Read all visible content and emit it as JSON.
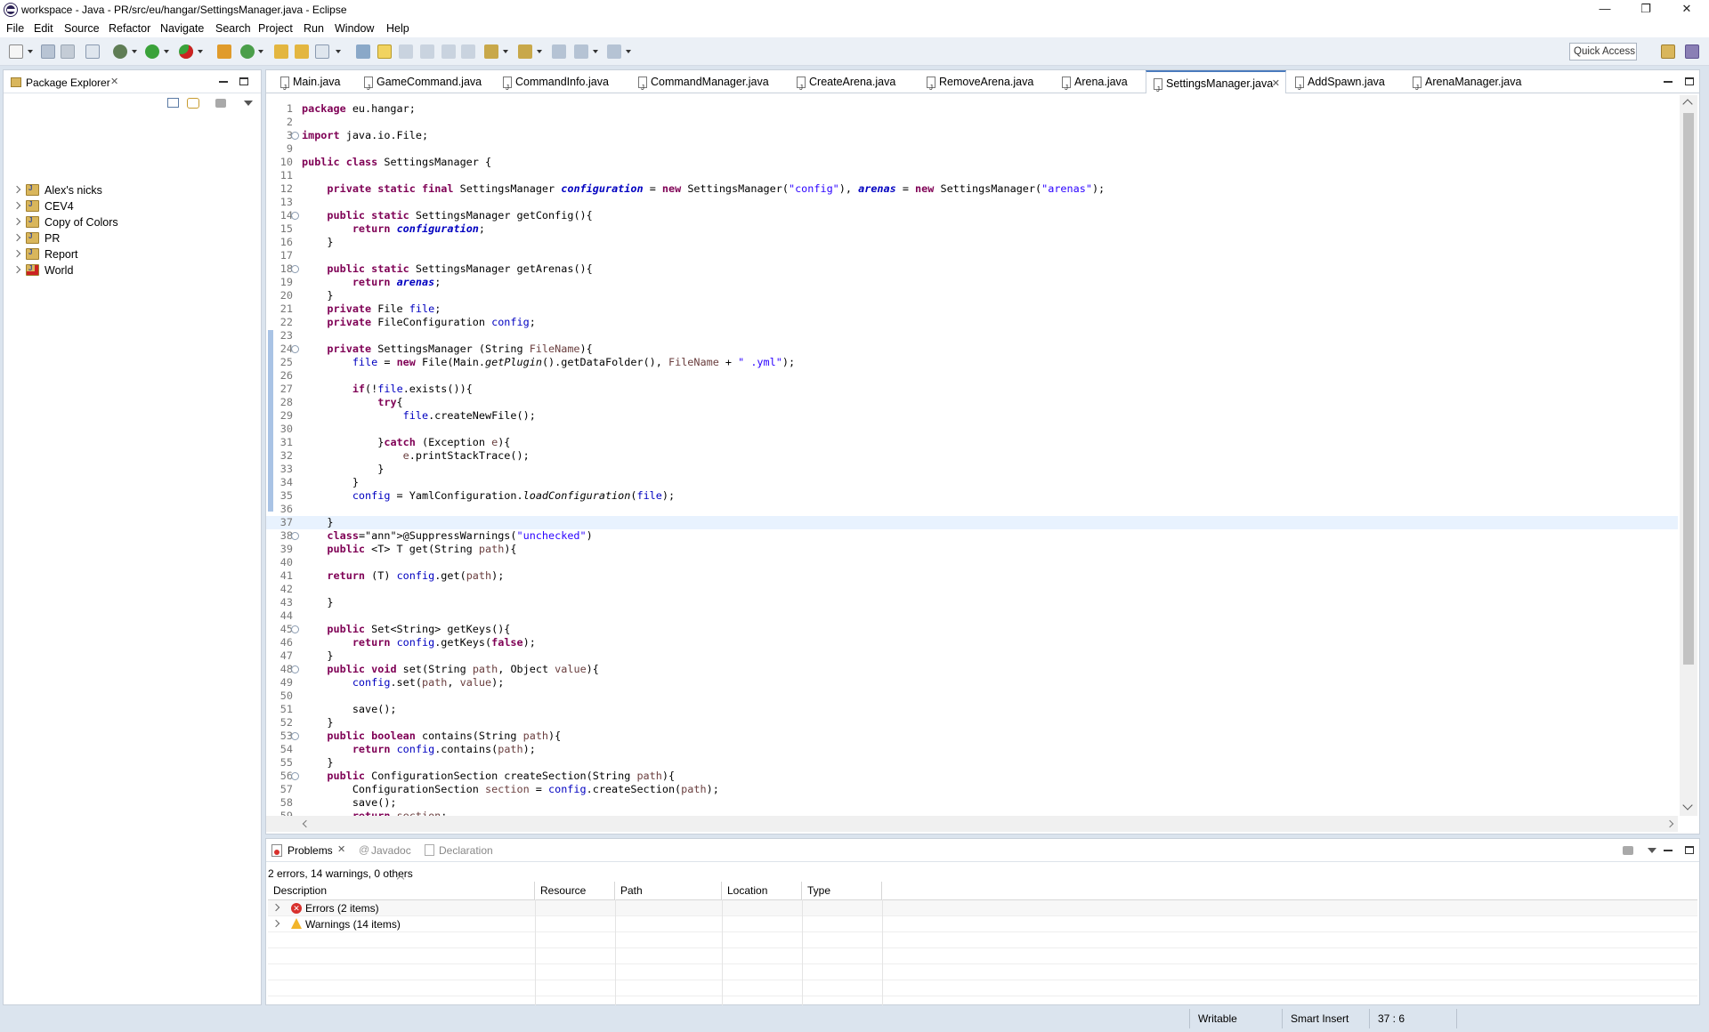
{
  "window": {
    "title": "workspace - Java - PR/src/eu/hangar/SettingsManager.java - Eclipse",
    "minimize": "—",
    "restore": "❐",
    "close": "✕"
  },
  "menu": [
    "File",
    "Edit",
    "Source",
    "Refactor",
    "Navigate",
    "Search",
    "Project",
    "Run",
    "Window",
    "Help"
  ],
  "quick_access": "Quick Access",
  "package_explorer": {
    "title": "Package Explorer",
    "projects": [
      "Alex's nicks",
      "CEV4",
      "Copy of Colors",
      "PR",
      "Report",
      "World"
    ]
  },
  "editor_tabs": [
    "Main.java",
    "GameCommand.java",
    "CommandInfo.java",
    "CommandManager.java",
    "CreateArena.java",
    "RemoveArena.java",
    "Arena.java",
    "SettingsManager.java",
    "AddSpawn.java",
    "ArenaManager.java"
  ],
  "active_tab": "SettingsManager.java",
  "code_lines": [
    {
      "n": "1",
      "t": "package eu.hangar;"
    },
    {
      "n": "2",
      "t": ""
    },
    {
      "n": "3",
      "t": "import java.io.File;"
    },
    {
      "n": "9",
      "t": ""
    },
    {
      "n": "10",
      "t": "public class SettingsManager {"
    },
    {
      "n": "11",
      "t": ""
    },
    {
      "n": "12",
      "t": "    private static final SettingsManager configuration = new SettingsManager(\"config\"), arenas = new SettingsManager(\"arenas\");"
    },
    {
      "n": "13",
      "t": ""
    },
    {
      "n": "14",
      "t": "    public static SettingsManager getConfig(){"
    },
    {
      "n": "15",
      "t": "        return configuration;"
    },
    {
      "n": "16",
      "t": "    }"
    },
    {
      "n": "17",
      "t": ""
    },
    {
      "n": "18",
      "t": "    public static SettingsManager getArenas(){"
    },
    {
      "n": "19",
      "t": "        return arenas;"
    },
    {
      "n": "20",
      "t": "    }"
    },
    {
      "n": "21",
      "t": "    private File file;"
    },
    {
      "n": "22",
      "t": "    private FileConfiguration config;"
    },
    {
      "n": "23",
      "t": ""
    },
    {
      "n": "24",
      "t": "    private SettingsManager (String FileName){"
    },
    {
      "n": "25",
      "t": "        file = new File(Main.getPlugin().getDataFolder(), FileName + \" .yml\");"
    },
    {
      "n": "26",
      "t": ""
    },
    {
      "n": "27",
      "t": "        if(!file.exists()){"
    },
    {
      "n": "28",
      "t": "            try{"
    },
    {
      "n": "29",
      "t": "                file.createNewFile();"
    },
    {
      "n": "30",
      "t": ""
    },
    {
      "n": "31",
      "t": "            }catch (Exception e){"
    },
    {
      "n": "32",
      "t": "                e.printStackTrace();"
    },
    {
      "n": "33",
      "t": "            }"
    },
    {
      "n": "34",
      "t": "        }"
    },
    {
      "n": "35",
      "t": "        config = YamlConfiguration.loadConfiguration(file);"
    },
    {
      "n": "36",
      "t": ""
    },
    {
      "n": "37",
      "t": "    }"
    },
    {
      "n": "38",
      "t": "    @SuppressWarnings(\"unchecked\")"
    },
    {
      "n": "39",
      "t": "    public <T> T get(String path){"
    },
    {
      "n": "40",
      "t": ""
    },
    {
      "n": "41",
      "t": "    return (T) config.get(path);"
    },
    {
      "n": "42",
      "t": ""
    },
    {
      "n": "43",
      "t": "    }"
    },
    {
      "n": "44",
      "t": ""
    },
    {
      "n": "45",
      "t": "    public Set<String> getKeys(){"
    },
    {
      "n": "46",
      "t": "        return config.getKeys(false);"
    },
    {
      "n": "47",
      "t": "    }"
    },
    {
      "n": "48",
      "t": "    public void set(String path, Object value){"
    },
    {
      "n": "49",
      "t": "        config.set(path, value);"
    },
    {
      "n": "50",
      "t": ""
    },
    {
      "n": "51",
      "t": "        save();"
    },
    {
      "n": "52",
      "t": "    }"
    },
    {
      "n": "53",
      "t": "    public boolean contains(String path){"
    },
    {
      "n": "54",
      "t": "        return config.contains(path);"
    },
    {
      "n": "55",
      "t": "    }"
    },
    {
      "n": "56",
      "t": "    public ConfigurationSection createSection(String path){"
    },
    {
      "n": "57",
      "t": "        ConfigurationSection section = config.createSection(path);"
    },
    {
      "n": "58",
      "t": "        save();"
    },
    {
      "n": "59",
      "t": "        return section;"
    }
  ],
  "bottom_tabs": [
    "Problems",
    "Javadoc",
    "Declaration"
  ],
  "problems": {
    "summary": "2 errors, 14 warnings, 0 others",
    "columns": [
      "Description",
      "Resource",
      "Path",
      "Location",
      "Type"
    ],
    "rows": [
      "Errors (2 items)",
      "Warnings (14 items)"
    ]
  },
  "status": {
    "writable": "Writable",
    "insert_mode": "Smart Insert",
    "position": "37 : 6"
  },
  "colors": {
    "keyword": "#7f0055",
    "string": "#2a00ff",
    "field": "#0000c0",
    "current_line": "#e8f2fe",
    "workbench_bg": "#dbe4ee"
  }
}
